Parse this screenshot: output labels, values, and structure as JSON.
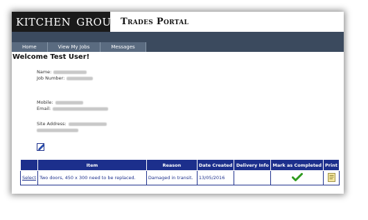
{
  "header": {
    "logo_part1": "KITCHEN",
    "logo_part2": "GROUP",
    "portal_title": "Trades Portal"
  },
  "nav": {
    "tabs": [
      {
        "label": "Home"
      },
      {
        "label": "View My Jobs"
      },
      {
        "label": "Messages"
      }
    ]
  },
  "main": {
    "welcome": "Welcome Test User!",
    "labels": {
      "name": "Name:",
      "job_number": "Job Number:",
      "mobile": "Mobile:",
      "email": "Email:",
      "site_address": "Site Address:"
    }
  },
  "table": {
    "headers": [
      "",
      "Item",
      "Reason",
      "Date Created",
      "Delivery Info",
      "Mark as Completed",
      "Print"
    ],
    "rows": [
      {
        "action": "Select",
        "item": "Two doors, 450 x 300 need to be replaced.",
        "reason": "Damaged in transit.",
        "date_created": "13/05/2016",
        "delivery_info": ""
      }
    ]
  },
  "colors": {
    "nav_band": "#3b4a5e",
    "table_header": "#1c2f8c",
    "check": "#2e9a1e"
  },
  "icons": {
    "edit": "edit-icon",
    "complete": "checkmark-icon",
    "print": "print-icon"
  }
}
